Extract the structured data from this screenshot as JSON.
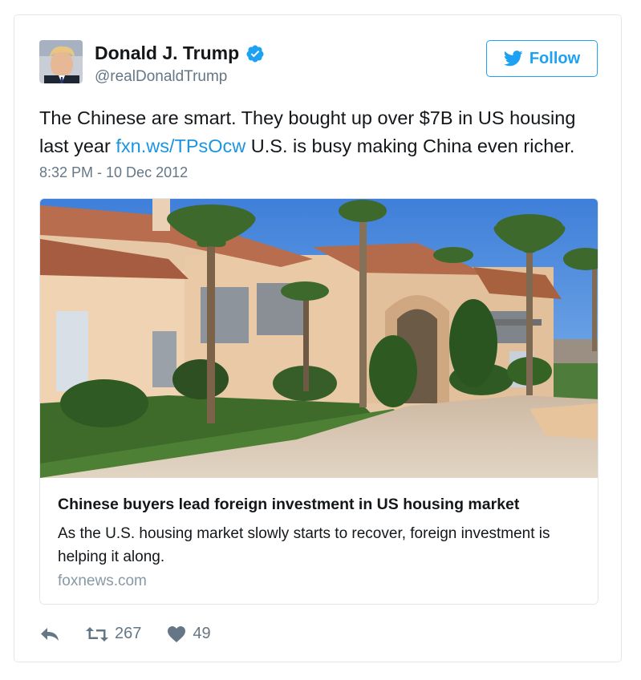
{
  "author": {
    "name": "Donald J. Trump",
    "handle": "@realDonaldTrump",
    "verified": true
  },
  "follow_button": {
    "label": "Follow"
  },
  "tweet": {
    "text_before_link": "The Chinese are smart. They bought up over $7B in US housing last year ",
    "link": "fxn.ws/TPsOcw",
    "text_after_link": " U.S. is busy making China even richer.",
    "timestamp": "8:32 PM - 10 Dec 2012"
  },
  "card": {
    "title": "Chinese buyers lead foreign investment in US housing market",
    "description": "As the U.S. housing market slowly starts to recover, foreign investment is helping it along.",
    "domain": "foxnews.com"
  },
  "actions": {
    "retweets": "267",
    "likes": "49"
  },
  "colors": {
    "brand_blue": "#1da1f2",
    "link_blue": "#1b95e0",
    "secondary_text": "#657786"
  }
}
